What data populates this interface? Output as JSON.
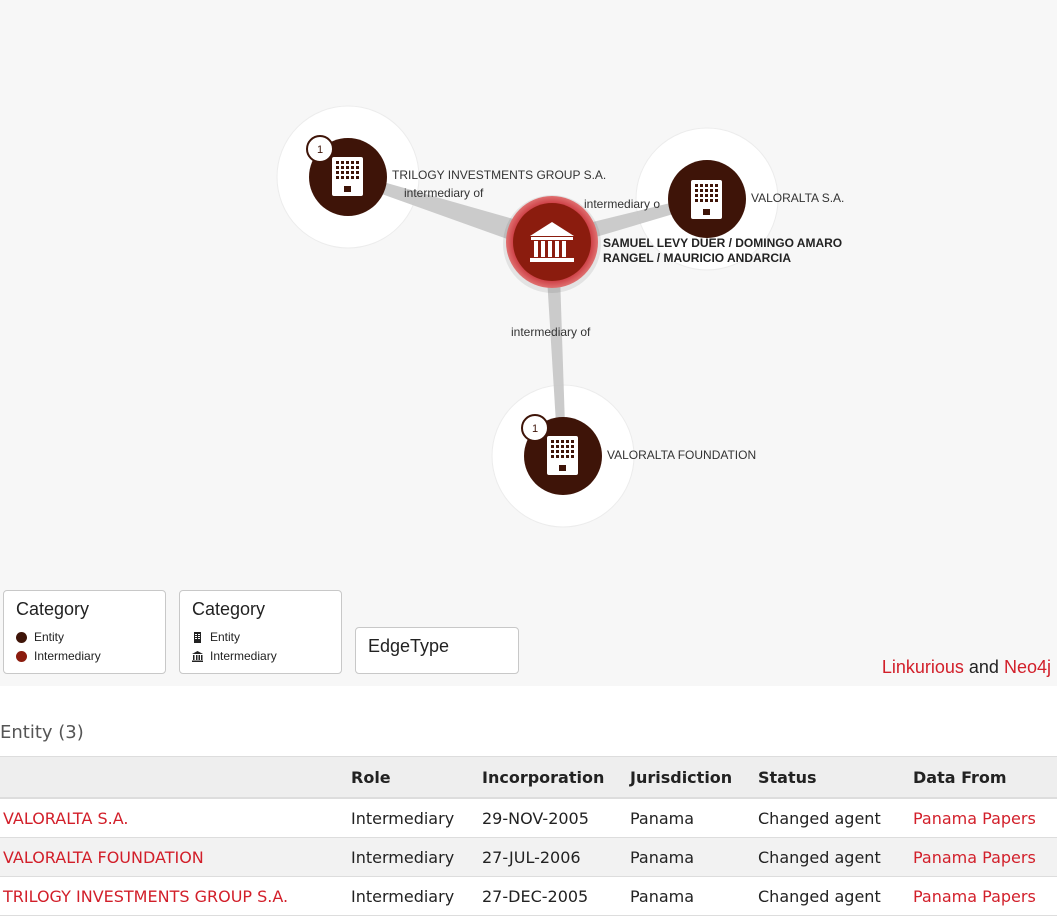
{
  "graph": {
    "nodes": {
      "trilogy": {
        "label": "TRILOGY INVESTMENTS GROUP S.A.",
        "badge": "1"
      },
      "valoralta_sa": {
        "label": "VALORALTA S.A."
      },
      "center": {
        "label": "SAMUEL LEVY DUER / DOMINGO AMARO RANGEL / MAURICIO ANDARCIA"
      },
      "foundation": {
        "label": "VALORALTA FOUNDATION",
        "badge": "1"
      }
    },
    "edges": {
      "e1": "intermediary of",
      "e2": "intermediary o",
      "e3": "intermediary of"
    },
    "colors": {
      "entity": "#3e1408",
      "intermediary": "#8b1c0e",
      "edge": "#c8c8c8",
      "link": "#d21f2a"
    }
  },
  "legends": {
    "category_colors": {
      "title": "Category",
      "items": [
        "Entity",
        "Intermediary"
      ]
    },
    "category_icons": {
      "title": "Category",
      "items": [
        "Entity",
        "Intermediary"
      ]
    },
    "edge_type": {
      "title": "EdgeType"
    }
  },
  "credits": {
    "link1": "Linkurious",
    "and": "and",
    "link2": "Neo4j"
  },
  "section": {
    "title": "Entity (3)"
  },
  "table": {
    "headers": [
      "",
      "Role",
      "Incorporation",
      "Jurisdiction",
      "Status",
      "Data From"
    ],
    "rows": [
      {
        "name": "VALORALTA S.A.",
        "role": "Intermediary",
        "incorporation": "29-NOV-2005",
        "jurisdiction": "Panama",
        "status": "Changed agent",
        "source": "Panama Papers"
      },
      {
        "name": "VALORALTA FOUNDATION",
        "role": "Intermediary",
        "incorporation": "27-JUL-2006",
        "jurisdiction": "Panama",
        "status": "Changed agent",
        "source": "Panama Papers"
      },
      {
        "name": "TRILOGY INVESTMENTS GROUP S.A.",
        "role": "Intermediary",
        "incorporation": "27-DEC-2005",
        "jurisdiction": "Panama",
        "status": "Changed agent",
        "source": "Panama Papers"
      }
    ]
  }
}
